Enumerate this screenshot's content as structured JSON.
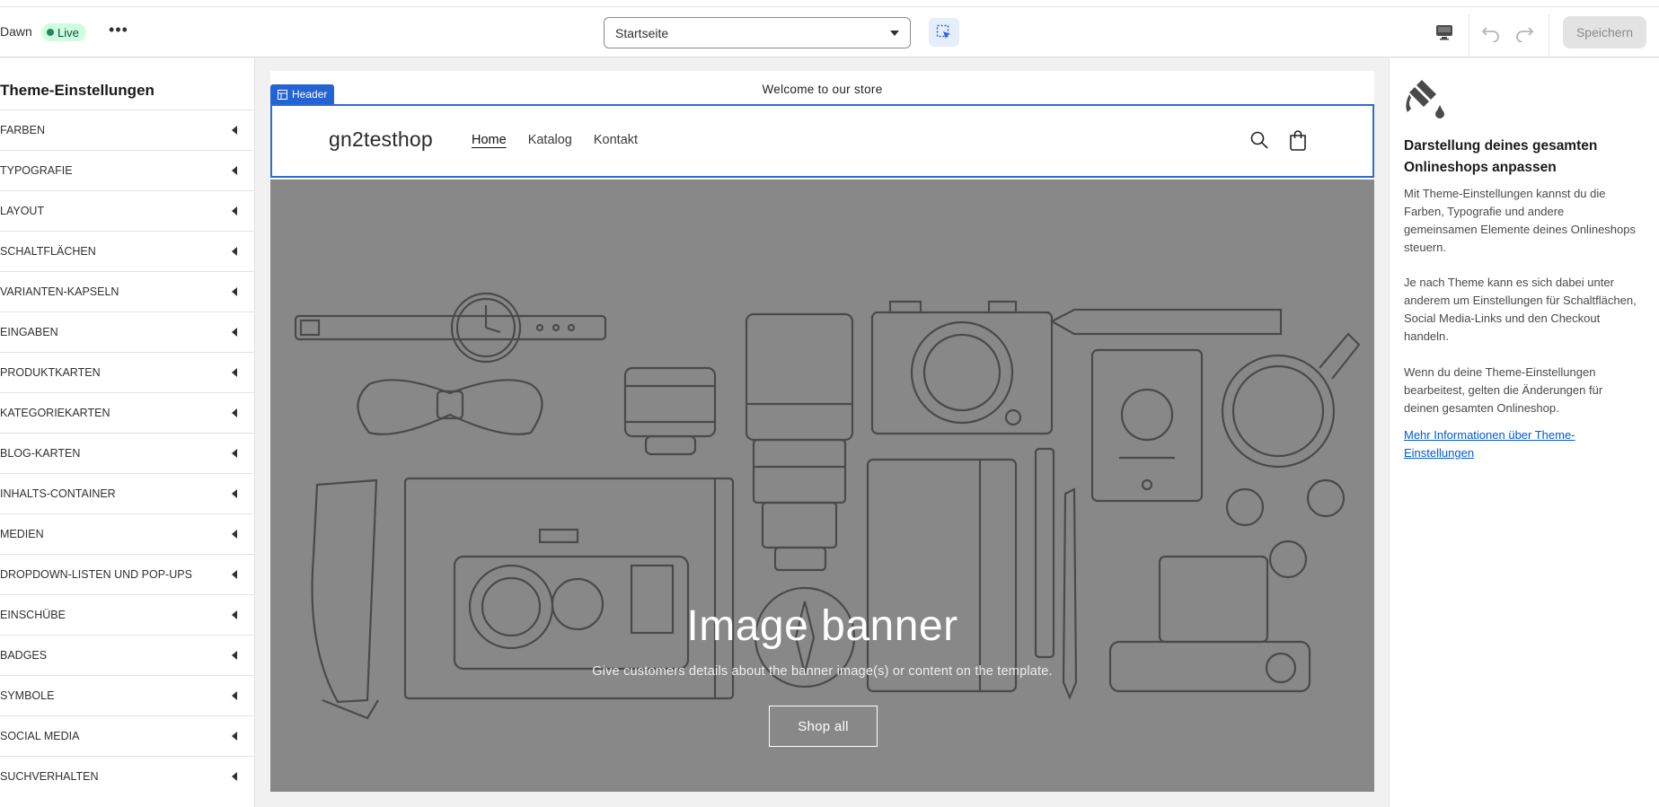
{
  "topbar": {
    "theme_name": "Dawn",
    "status": "Live",
    "more_label": "•••",
    "page_select": "Startseite",
    "save_label": "Speichern"
  },
  "sidebar": {
    "title": "Theme-Einstellungen",
    "items": [
      {
        "label": "FARBEN"
      },
      {
        "label": "TYPOGRAFIE"
      },
      {
        "label": "LAYOUT"
      },
      {
        "label": "SCHALTFLÄCHEN"
      },
      {
        "label": "VARIANTEN-KAPSELN"
      },
      {
        "label": "EINGABEN"
      },
      {
        "label": "PRODUKTKARTEN"
      },
      {
        "label": "KATEGORIEKARTEN"
      },
      {
        "label": "BLOG-KARTEN"
      },
      {
        "label": "INHALTS-CONTAINER"
      },
      {
        "label": "MEDIEN"
      },
      {
        "label": "DROPDOWN-LISTEN UND POP-UPS"
      },
      {
        "label": "EINSCHÜBE"
      },
      {
        "label": "BADGES"
      },
      {
        "label": "SYMBOLE"
      },
      {
        "label": "SOCIAL MEDIA"
      },
      {
        "label": "SUCHVERHALTEN"
      }
    ]
  },
  "preview": {
    "announcement": "Welcome to our store",
    "header_tag": "Header",
    "logo": "gn2testhop",
    "nav": [
      "Home",
      "Katalog",
      "Kontakt"
    ],
    "banner_title": "Image banner",
    "banner_subtitle": "Give customers details about the banner image(s) or content on the template.",
    "banner_button": "Shop all"
  },
  "info": {
    "title": "Darstellung deines gesamten Onlineshops anpassen",
    "p1": "Mit Theme-Einstellungen kannst du die Farben, Typografie und andere gemeinsamen Elemente deines Onlineshops steuern.",
    "p2": "Je nach Theme kann es sich dabei unter anderem um Einstellungen für Schaltflächen, Social Media-Links und den Checkout handeln.",
    "p3": "Wenn du deine Theme-Einstellungen bearbeitest, gelten die Änderungen für deinen gesamten Onlineshop.",
    "link": "Mehr Informationen über Theme-Einstellungen"
  },
  "colors": {
    "accent": "#2c6ecb",
    "live_bg": "#cdfee1",
    "banner_bg": "#888888"
  }
}
